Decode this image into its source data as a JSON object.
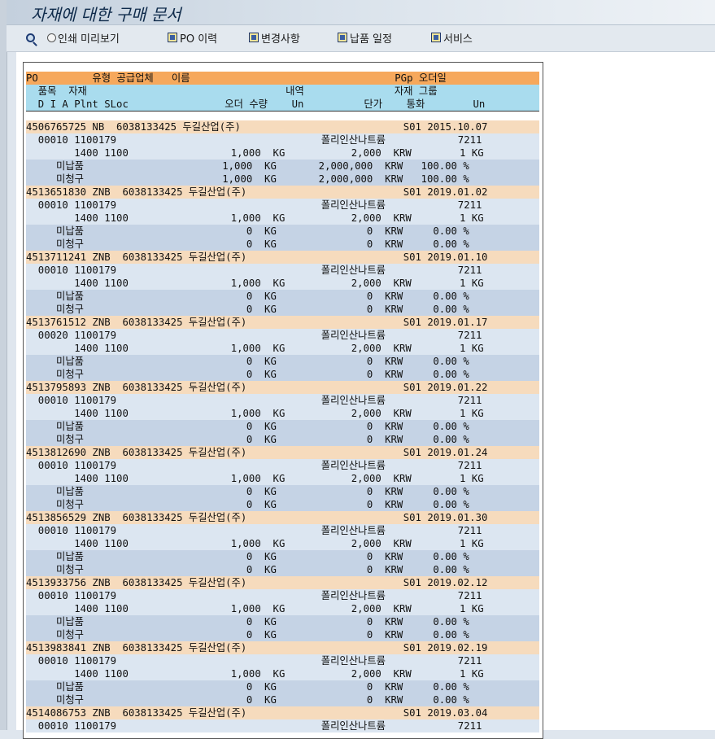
{
  "title": "자재에 대한 구매 문서",
  "toolbar": {
    "items": [
      {
        "name": "find",
        "label": ""
      },
      {
        "name": "print-preview",
        "label": "인쇄 미리보기"
      },
      {
        "name": "po-history",
        "label": "PO 이력"
      },
      {
        "name": "changes",
        "label": "변경사항"
      },
      {
        "name": "delivery-schedule",
        "label": "납품 일정"
      },
      {
        "name": "services",
        "label": "서비스"
      }
    ]
  },
  "list": {
    "header_rows": [
      "PO         유형 공급업체   이름                                  PGp 오더일    ",
      "  품목  자재                                 내역               자재 그룹",
      "  D I A Plnt SLoc                오더 수량    Un          단가    통화        Un"
    ],
    "rows": [
      {
        "type": "po",
        "text": "4506765725 NB  6038133425 두길산업(주)                           S01 2015.10.07"
      },
      {
        "type": "item",
        "text": "  00010 1100179                                  폴리인산나트륨            7211"
      },
      {
        "type": "item",
        "text": "        1400 1100                 1,000  KG           2,000  KRW        1 KG"
      },
      {
        "type": "sub",
        "text": "     미납품                       1,000  KG       2,000,000  KRW   100.00 %"
      },
      {
        "type": "sub",
        "text": "     미청구                       1,000  KG       2,000,000  KRW   100.00 %"
      },
      {
        "type": "po",
        "text": "4513651830 ZNB  6038133425 두길산업(주)                          S01 2019.01.02"
      },
      {
        "type": "item",
        "text": "  00010 1100179                                  폴리인산나트륨            7211"
      },
      {
        "type": "item",
        "text": "        1400 1100                 1,000  KG           2,000  KRW        1 KG"
      },
      {
        "type": "sub",
        "text": "     미납품                           0  KG               0  KRW     0.00 %"
      },
      {
        "type": "sub",
        "text": "     미청구                           0  KG               0  KRW     0.00 %"
      },
      {
        "type": "po",
        "text": "4513711241 ZNB  6038133425 두길산업(주)                          S01 2019.01.10"
      },
      {
        "type": "item",
        "text": "  00010 1100179                                  폴리인산나트륨            7211"
      },
      {
        "type": "item",
        "text": "        1400 1100                 1,000  KG           2,000  KRW        1 KG"
      },
      {
        "type": "sub",
        "text": "     미납품                           0  KG               0  KRW     0.00 %"
      },
      {
        "type": "sub",
        "text": "     미청구                           0  KG               0  KRW     0.00 %"
      },
      {
        "type": "po",
        "text": "4513761512 ZNB  6038133425 두길산업(주)                          S01 2019.01.17"
      },
      {
        "type": "item",
        "text": "  00020 1100179                                  폴리인산나트륨            7211"
      },
      {
        "type": "item",
        "text": "        1400 1100                 1,000  KG           2,000  KRW        1 KG"
      },
      {
        "type": "sub",
        "text": "     미납품                           0  KG               0  KRW     0.00 %"
      },
      {
        "type": "sub",
        "text": "     미청구                           0  KG               0  KRW     0.00 %"
      },
      {
        "type": "po",
        "text": "4513795893 ZNB  6038133425 두길산업(주)                          S01 2019.01.22"
      },
      {
        "type": "item",
        "text": "  00010 1100179                                  폴리인산나트륨            7211"
      },
      {
        "type": "item",
        "text": "        1400 1100                 1,000  KG           2,000  KRW        1 KG"
      },
      {
        "type": "sub",
        "text": "     미납품                           0  KG               0  KRW     0.00 %"
      },
      {
        "type": "sub",
        "text": "     미청구                           0  KG               0  KRW     0.00 %"
      },
      {
        "type": "po",
        "text": "4513812690 ZNB  6038133425 두길산업(주)                          S01 2019.01.24"
      },
      {
        "type": "item",
        "text": "  00010 1100179                                  폴리인산나트륨            7211"
      },
      {
        "type": "item",
        "text": "        1400 1100                 1,000  KG           2,000  KRW        1 KG"
      },
      {
        "type": "sub",
        "text": "     미납품                           0  KG               0  KRW     0.00 %"
      },
      {
        "type": "sub",
        "text": "     미청구                           0  KG               0  KRW     0.00 %"
      },
      {
        "type": "po",
        "text": "4513856529 ZNB  6038133425 두길산업(주)                          S01 2019.01.30"
      },
      {
        "type": "item",
        "text": "  00010 1100179                                  폴리인산나트륨            7211"
      },
      {
        "type": "item",
        "text": "        1400 1100                 1,000  KG           2,000  KRW        1 KG"
      },
      {
        "type": "sub",
        "text": "     미납품                           0  KG               0  KRW     0.00 %"
      },
      {
        "type": "sub",
        "text": "     미청구                           0  KG               0  KRW     0.00 %"
      },
      {
        "type": "po",
        "text": "4513933756 ZNB  6038133425 두길산업(주)                          S01 2019.02.12"
      },
      {
        "type": "item",
        "text": "  00010 1100179                                  폴리인산나트륨            7211"
      },
      {
        "type": "item",
        "text": "        1400 1100                 1,000  KG           2,000  KRW        1 KG"
      },
      {
        "type": "sub",
        "text": "     미납품                           0  KG               0  KRW     0.00 %"
      },
      {
        "type": "sub",
        "text": "     미청구                           0  KG               0  KRW     0.00 %"
      },
      {
        "type": "po",
        "text": "4513983841 ZNB  6038133425 두길산업(주)                          S01 2019.02.19"
      },
      {
        "type": "item",
        "text": "  00010 1100179                                  폴리인산나트륨            7211"
      },
      {
        "type": "item",
        "text": "        1400 1100                 1,000  KG           2,000  KRW        1 KG"
      },
      {
        "type": "sub",
        "text": "     미납품                           0  KG               0  KRW     0.00 %"
      },
      {
        "type": "sub",
        "text": "     미청구                           0  KG               0  KRW     0.00 %"
      },
      {
        "type": "po",
        "text": "4514086753 ZNB  6038133425 두길산업(주)                          S01 2019.03.04"
      },
      {
        "type": "item",
        "text": "  00010 1100179                                  폴리인산나트륨            7211"
      }
    ]
  }
}
